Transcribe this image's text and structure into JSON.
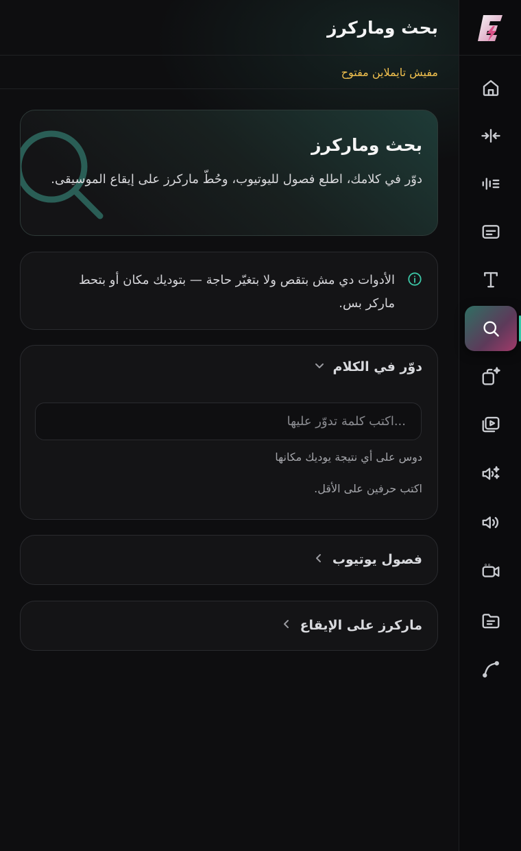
{
  "header": {
    "title": "بحث وماركرز"
  },
  "timeline_status": "مفيش تايملاين مفتوح",
  "hero": {
    "title": "بحث وماركرز",
    "description": "دوّر في كلامك، اطلع فصول لليوتيوب، وحُطّ ماركرز على إيقاع الموسيقى."
  },
  "info": {
    "text": "الأدوات دي مش بتقص ولا بتغيّر حاجة — بتوديك مكان أو بتحط ماركر بس."
  },
  "search_section": {
    "title": "دوّر في الكلام",
    "placeholder": "...اكتب كلمة تدوّر عليها",
    "value": "",
    "hint_click": "دوس على أي نتيجة يوديك مكانها",
    "hint_min": "اكتب حرفين على الأقل."
  },
  "youtube_section": {
    "title": "فصول يوتيوب"
  },
  "beat_section": {
    "title": "ماركرز على الإيقاع"
  },
  "rail": {
    "items": [
      "home-icon",
      "split-icon",
      "audio-bars-icon",
      "subtitles-icon",
      "text-icon",
      "search-icon",
      "copy-sparkle-icon",
      "video-library-icon",
      "voice-sparkle-icon",
      "volume-icon",
      "camera-icon",
      "folder-icon",
      "curve-icon"
    ],
    "active": "search-icon"
  },
  "colors": {
    "accent_teal": "#3cc6a6",
    "status_yellow": "#f2c14e",
    "active_gradient_start": "#2f6f63",
    "active_gradient_end": "#a23a6a"
  }
}
